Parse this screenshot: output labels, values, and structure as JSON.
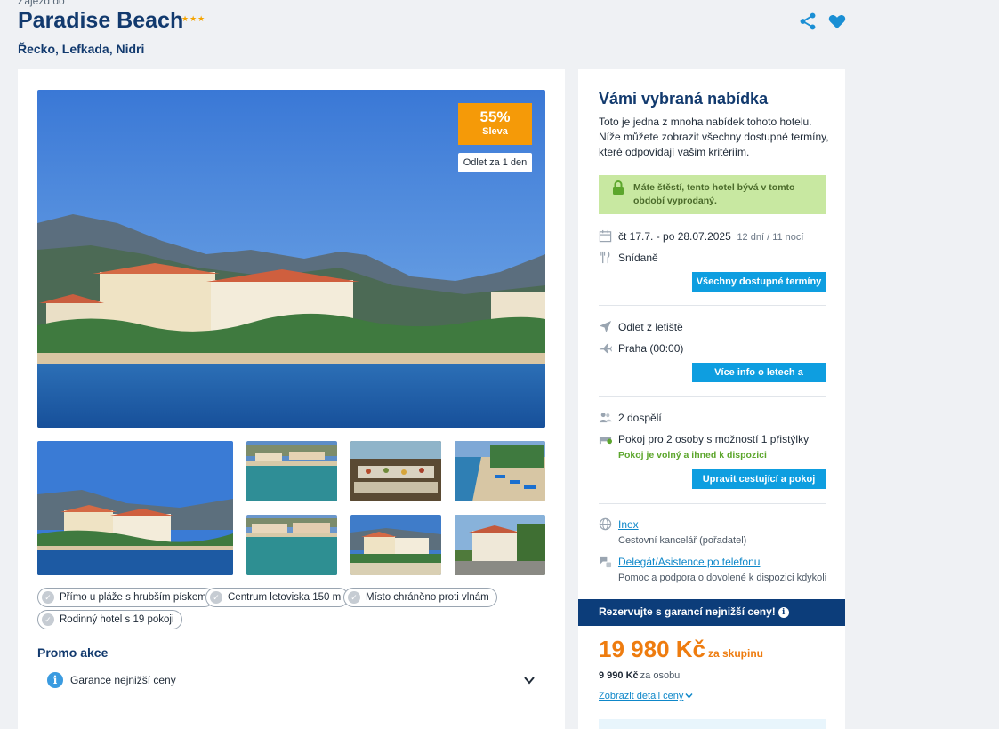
{
  "header": {
    "breadcrumb": "Zájezd do",
    "title": "Paradise Beach",
    "stars": "★★★",
    "location": "Řecko, Lefkada, Nidri"
  },
  "gallery": {
    "discount_pct": "55%",
    "discount_label": "Sleva",
    "depart_badge": "Odlet za 1 den"
  },
  "tags": [
    "Přímo u pláže s hrubším pískem",
    "Centrum letoviska 150 m",
    "Místo chráněno proti vlnám",
    "Rodinný hotel s 19 pokoji"
  ],
  "promo": {
    "title": "Promo akce",
    "item": "Garance nejnižší ceny"
  },
  "offer": {
    "title": "Vámi vybraná nabídka",
    "description": "Toto je jedna z mnoha nabídek tohoto hotelu. Níže můžete zobrazit všechny dostupné termíny, které odpovídají vašim kritériím.",
    "notice": "Máte štěstí, tento hotel bývá v tomto období vyprodaný.",
    "dates": "čt 17.7. - po 28.07.2025",
    "duration": "12 dní / 11 nocí",
    "board": "Snídaně",
    "btn_dates": "Všechny dostupné termíny",
    "flight_label": "Odlet z letiště",
    "flight_airport": "Praha (00:00)",
    "btn_flights": "Více info o letech a alternativy",
    "travelers": "2 dospělí",
    "room": "Pokoj pro 2 osoby s možností 1 přistýlky",
    "room_note": "Pokoj je volný a ihned k dispozici",
    "btn_room": "Upravit cestující a pokoj",
    "agency": "Inex",
    "agency_sub": "Cestovní kancelář (pořadatel)",
    "support": "Delegát/Asistence po telefonu",
    "support_sub": "Pomoc a podpora o dovolené k dispozici kdykoli",
    "guarantee": "Rezervujte s garancí nejnižší ceny!",
    "price": "19 980 Kč",
    "price_suffix": "za skupinu",
    "per_person_price": "9 990 Kč",
    "per_person_label": "za osobu",
    "detail_link": "Zobrazit detail ceny"
  },
  "colors": {
    "brand_navy": "#123a6e",
    "accent_blue": "#0e9ee0",
    "price_orange": "#ee7c0f",
    "discount_orange": "#f59a08",
    "notice_green": "#c8e8a1"
  }
}
